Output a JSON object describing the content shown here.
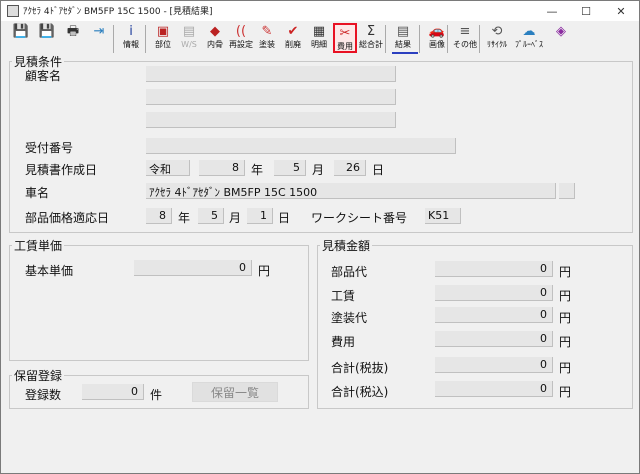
{
  "window": {
    "title": "ｱｸｾﾗ 4ﾄﾞｱｾﾀﾞﾝ BM5FP 15C 1500 - [見積結果]",
    "minimize": "—",
    "maximize": "☐",
    "close": "✕"
  },
  "toolbar": [
    {
      "name": "save",
      "label": "",
      "glyph": "💾",
      "color": "#1a4ea0"
    },
    {
      "name": "save-as",
      "label": "",
      "glyph": "💾",
      "color": "#1a4ea0"
    },
    {
      "name": "print",
      "label": "",
      "glyph": "🖶",
      "color": "#333"
    },
    {
      "name": "exit",
      "label": "",
      "glyph": "⇥",
      "color": "#2a7fbf"
    },
    {
      "name": "info",
      "label": "情報",
      "glyph": "i",
      "color": "#1f3e9c"
    },
    {
      "name": "parts",
      "label": "部位",
      "glyph": "▣",
      "color": "#b22"
    },
    {
      "name": "ws",
      "label": "W/S",
      "glyph": "▤",
      "color": "#aaa"
    },
    {
      "name": "internal",
      "label": "内骨",
      "glyph": "◆",
      "color": "#b22"
    },
    {
      "name": "recalc",
      "label": "再設定",
      "glyph": "((",
      "color": "#c33"
    },
    {
      "name": "paint",
      "label": "塗装",
      "glyph": "✎",
      "color": "#c33"
    },
    {
      "name": "disposal",
      "label": "削廃",
      "glyph": "✔",
      "color": "#c22"
    },
    {
      "name": "detail",
      "label": "明細",
      "glyph": "▦",
      "color": "#333"
    },
    {
      "name": "cost",
      "label": "費用",
      "glyph": "✂",
      "color": "#c22"
    },
    {
      "name": "total",
      "label": "総合計",
      "glyph": "Σ",
      "color": "#333"
    },
    {
      "name": "result",
      "label": "結果",
      "glyph": "▤",
      "color": "#555"
    },
    {
      "name": "image",
      "label": "画像",
      "glyph": "🚗",
      "color": "#c22"
    },
    {
      "name": "other",
      "label": "その他",
      "glyph": "≡",
      "color": "#555"
    },
    {
      "name": "recycle",
      "label": "ﾘｻｲｸﾙ",
      "glyph": "⟲",
      "color": "#555"
    },
    {
      "name": "proofnet",
      "label": "ﾌﾟﾙｰﾍﾞｽ",
      "glyph": "☁",
      "color": "#2a7fbf"
    },
    {
      "name": "extra",
      "label": "",
      "glyph": "◈",
      "color": "#8a2aa0"
    }
  ],
  "estimate_conditions": {
    "legend": "見積条件",
    "customer_label": "顧客名",
    "customer_lines": [
      "",
      "",
      ""
    ],
    "reception_label": "受付番号",
    "reception_value": "",
    "created_label": "見積書作成日",
    "era": "令和",
    "year": "8",
    "year_unit": "年",
    "month": "5",
    "month_unit": "月",
    "day": "26",
    "day_unit": "日",
    "vehicle_label": "車名",
    "vehicle_value": "ｱｸｾﾗ 4ﾄﾞｱｾﾀﾞﾝ BM5FP 15C 1500",
    "price_date_label": "部品価格適応日",
    "price_year": "8",
    "price_month": "5",
    "price_day": "1",
    "worksheet_label": "ワークシート番号",
    "worksheet_value": "K51"
  },
  "labor": {
    "legend": "工賃単価",
    "base_label": "基本単価",
    "base_value": "0",
    "unit": "円"
  },
  "quote": {
    "legend": "見積金額",
    "rows": [
      {
        "label": "部品代",
        "value": "0",
        "unit": "円"
      },
      {
        "label": "工賃",
        "value": "0",
        "unit": "円"
      },
      {
        "label": "塗装代",
        "value": "0",
        "unit": "円"
      },
      {
        "label": "費用",
        "value": "0",
        "unit": "円"
      },
      {
        "label": "合計(税抜)",
        "value": "0",
        "unit": "円"
      },
      {
        "label": "合計(税込)",
        "value": "0",
        "unit": "円"
      }
    ]
  },
  "hold": {
    "legend": "保留登録",
    "count_label": "登録数",
    "count_value": "0",
    "count_unit": "件",
    "list_button": "保留一覧"
  }
}
